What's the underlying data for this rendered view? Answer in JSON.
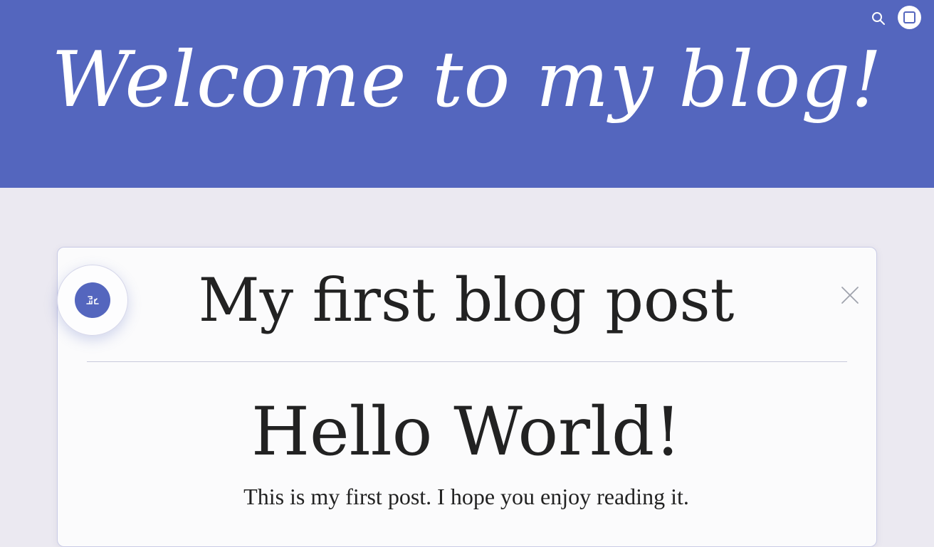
{
  "header": {
    "title": "Welcome to my blog!",
    "background_color": "#5466be",
    "icons": [
      "search-icon",
      "window-icon"
    ]
  },
  "post": {
    "title": "My first blog post",
    "heading": "Hello World!",
    "body": "This is my first post. I hope you enjoy reading it."
  },
  "fab": {
    "icon": "edit-icon",
    "color": "#5466be"
  },
  "close": {
    "icon": "close-icon"
  }
}
